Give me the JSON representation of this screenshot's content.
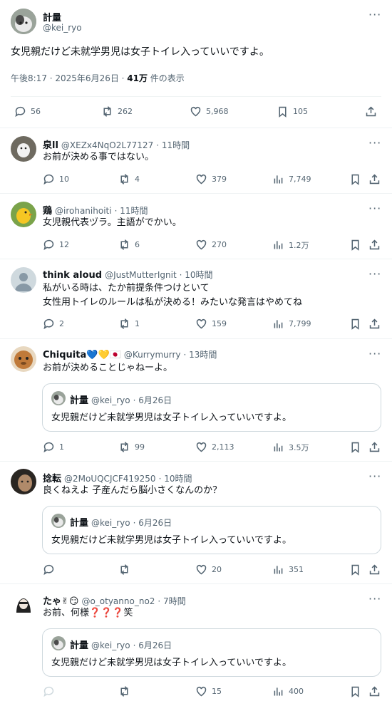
{
  "main_tweet": {
    "author_name": "計量",
    "author_handle": "@kei_ryo",
    "text": "女児親だけど未就学男児は女子トイレ入っていいですよ。",
    "time": "午後8:17 · 2025年6月26日 · ",
    "views_count": "41万",
    "views_label": " 件の表示",
    "replies": "56",
    "retweets": "262",
    "likes": "5,968",
    "bookmarks": "105"
  },
  "replies": [
    {
      "name": "泉ll",
      "handle": "@XEZx4NqO2L77127",
      "time": "· 11時間",
      "text": "お前が決める事ではない。",
      "replies": "10",
      "retweets": "4",
      "likes": "379",
      "views": "7,749"
    },
    {
      "name": "鶏",
      "handle": "@irohanihoiti",
      "time": "· 11時間",
      "text": "女児親代表ヅラ。主語がでかい。",
      "replies": "12",
      "retweets": "6",
      "likes": "270",
      "views": "1.2万"
    },
    {
      "name": "think aloud",
      "handle": "@JustMutterIgnit",
      "time": "· 10時間",
      "text": "私がいる時は、たか前提条件つけといて",
      "text2": "女性用トイレのルールは私が決める！みたいな発言はやめてね",
      "replies": "2",
      "retweets": "1",
      "likes": "159",
      "views": "7,799"
    },
    {
      "name": "Chiquita💙💛🇯🇵",
      "handle": "@Kurrymurry",
      "time": "· 13時間",
      "text": "お前が決めることじゃねーよ。",
      "replies": "1",
      "retweets": "99",
      "likes": "2,113",
      "views": "3.5万"
    },
    {
      "name": "捻転",
      "handle": "@2MoUQCJCF419250",
      "time": "· 10時間",
      "text": "良くねえよ 子産んだら脳小さくなんのか？",
      "replies": "",
      "retweets": "",
      "likes": "20",
      "views": "351"
    },
    {
      "name": "たゃ✌😏",
      "handle": "@o_otyanno_no2",
      "time": "· 7時間",
      "text": "お前、何様❓❓❓笑",
      "replies": "",
      "retweets": "",
      "likes": "15",
      "views": "400"
    }
  ],
  "quote": {
    "name": "計量",
    "handle": "@kei_ryo",
    "date": "· 6月26日",
    "text": "女児親だけど未就学男児は女子トイレ入っていいですよ。"
  },
  "more_glyph": "···"
}
